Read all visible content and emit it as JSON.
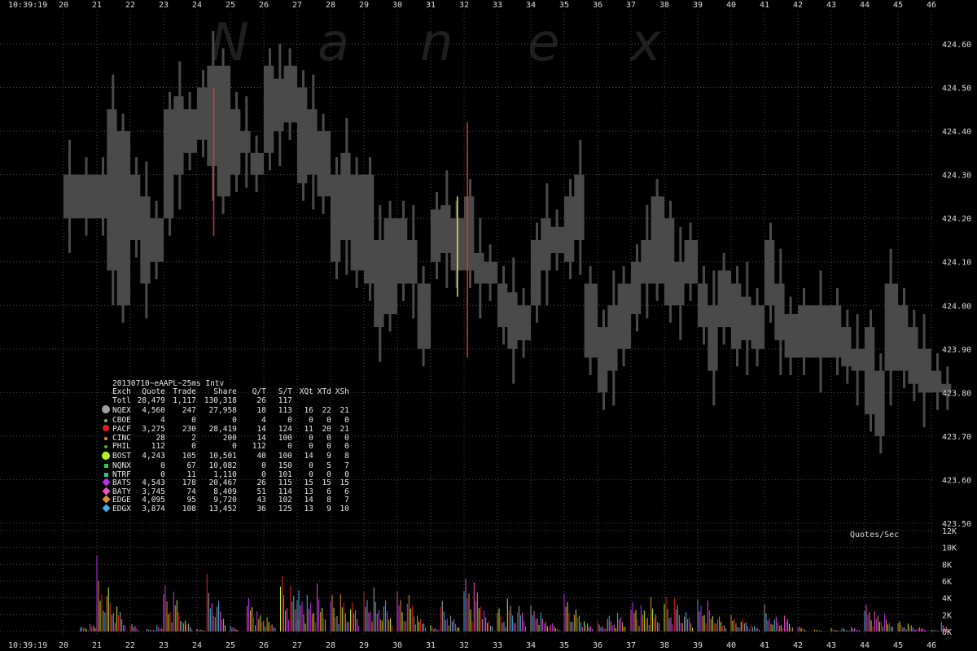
{
  "header_time": "10:39:19",
  "footer_time": "10:39:19",
  "watermark": [
    "N",
    "a",
    "n",
    "e",
    "x"
  ],
  "x_ticks": [
    "20",
    "21",
    "22",
    "23",
    "24",
    "25",
    "26",
    "27",
    "28",
    "29",
    "30",
    "31",
    "32",
    "33",
    "34",
    "35",
    "36",
    "37",
    "38",
    "39",
    "40",
    "41",
    "42",
    "43",
    "44",
    "45",
    "46"
  ],
  "price_ticks": [
    "424.60",
    "424.50",
    "424.40",
    "424.30",
    "424.20",
    "424.10",
    "424.00",
    "423.90",
    "423.80",
    "423.70",
    "423.60",
    "423.50"
  ],
  "volume_ticks": [
    "12K",
    "10K",
    "8K",
    "6K",
    "4K",
    "2K",
    "0K"
  ],
  "volume_label": "Quotes/Sec",
  "stats": {
    "title": "20130710~eAAPL~25ms Intv",
    "headers": [
      "Exch",
      "Quote",
      "Trade",
      "Share",
      "Q/T",
      "S/T",
      "XQt",
      "XTd",
      "XSh"
    ],
    "rows": [
      {
        "exch": "Totl",
        "quote": "28,479",
        "trade": "1,117",
        "share": "130,318",
        "qt": "26",
        "st": "117",
        "xqt": "",
        "xtd": "",
        "xsh": "",
        "color": "",
        "shape": "none"
      },
      {
        "exch": "NQEX",
        "quote": "4,560",
        "trade": "247",
        "share": "27,958",
        "qt": "18",
        "st": "113",
        "xqt": "16",
        "xtd": "22",
        "xsh": "21",
        "color": "#a0a0a0",
        "shape": "big-dot"
      },
      {
        "exch": "CBOE",
        "quote": "4",
        "trade": "0",
        "share": "0",
        "qt": "4",
        "st": "0",
        "xqt": "0",
        "xtd": "0",
        "xsh": "0",
        "color": "#6ac04a",
        "shape": "small-dot"
      },
      {
        "exch": "PACF",
        "quote": "3,275",
        "trade": "230",
        "share": "28,419",
        "qt": "14",
        "st": "124",
        "xqt": "11",
        "xtd": "20",
        "xsh": "21",
        "color": "#e21b1b",
        "shape": "dot"
      },
      {
        "exch": "CINC",
        "quote": "28",
        "trade": "2",
        "share": "200",
        "qt": "14",
        "st": "100",
        "xqt": "0",
        "xtd": "0",
        "xsh": "0",
        "color": "#e0922a",
        "shape": "small-dot"
      },
      {
        "exch": "PHIL",
        "quote": "112",
        "trade": "0",
        "share": "0",
        "qt": "112",
        "st": "0",
        "xqt": "0",
        "xtd": "0",
        "xsh": "0",
        "color": "#44b030",
        "shape": "small-dot"
      },
      {
        "exch": "BOST",
        "quote": "4,243",
        "trade": "105",
        "share": "10,501",
        "qt": "40",
        "st": "100",
        "xqt": "14",
        "xtd": "9",
        "xsh": "8",
        "color": "#b4f028",
        "shape": "big-dot"
      },
      {
        "exch": "NQNX",
        "quote": "0",
        "trade": "67",
        "share": "10,082",
        "qt": "0",
        "st": "150",
        "xqt": "0",
        "xtd": "5",
        "xsh": "7",
        "color": "#2ec84a",
        "shape": "square"
      },
      {
        "exch": "NTRF",
        "quote": "0",
        "trade": "11",
        "share": "1,110",
        "qt": "0",
        "st": "101",
        "xqt": "0",
        "xtd": "0",
        "xsh": "0",
        "color": "#2ec88a",
        "shape": "square"
      },
      {
        "exch": "BATS",
        "quote": "4,543",
        "trade": "178",
        "share": "20,467",
        "qt": "26",
        "st": "115",
        "xqt": "15",
        "xtd": "15",
        "xsh": "15",
        "color": "#c030f0",
        "shape": "diamond"
      },
      {
        "exch": "BATY",
        "quote": "3,745",
        "trade": "74",
        "share": "8,409",
        "qt": "51",
        "st": "114",
        "xqt": "13",
        "xtd": "6",
        "xsh": "6",
        "color": "#f050c8",
        "shape": "diamond"
      },
      {
        "exch": "EDGE",
        "quote": "4,095",
        "trade": "95",
        "share": "9,720",
        "qt": "43",
        "st": "102",
        "xqt": "14",
        "xtd": "8",
        "xsh": "7",
        "color": "#e0902a",
        "shape": "diamond"
      },
      {
        "exch": "EDGX",
        "quote": "3,874",
        "trade": "108",
        "share": "13,452",
        "qt": "36",
        "st": "125",
        "xqt": "13",
        "xtd": "9",
        "xsh": "10",
        "color": "#40b0e8",
        "shape": "diamond"
      }
    ]
  },
  "colors": {
    "band": "#4a4a4a",
    "grid": "#4d4d4d",
    "background": "#000000",
    "trade_red": "#d23a3a",
    "trade_yellow": "#e6e64a"
  },
  "chart_data": {
    "type": "area",
    "title": "",
    "x_unit": "seconds after 10:39",
    "price_axis": {
      "ylim": [
        423.5,
        424.6
      ]
    },
    "volume_axis": {
      "ylim": [
        0,
        12000
      ]
    },
    "nbbo_band": [
      [
        20.0,
        424.3,
        424.2
      ],
      [
        20.5,
        424.3,
        424.2
      ],
      [
        21.0,
        424.3,
        424.2
      ],
      [
        21.3,
        424.45,
        424.08
      ],
      [
        21.6,
        424.4,
        424.0
      ],
      [
        22.0,
        424.3,
        424.15
      ],
      [
        22.3,
        424.25,
        424.05
      ],
      [
        22.6,
        424.2,
        424.1
      ],
      [
        23.0,
        424.45,
        424.2
      ],
      [
        23.3,
        424.48,
        424.3
      ],
      [
        23.6,
        424.45,
        424.35
      ],
      [
        24.0,
        424.5,
        424.38
      ],
      [
        24.3,
        424.55,
        424.32
      ],
      [
        24.6,
        424.55,
        424.25
      ],
      [
        25.0,
        424.45,
        424.3
      ],
      [
        25.3,
        424.4,
        424.35
      ],
      [
        25.6,
        424.35,
        424.3
      ],
      [
        26.0,
        424.55,
        424.35
      ],
      [
        26.3,
        424.52,
        424.4
      ],
      [
        26.6,
        424.55,
        424.42
      ],
      [
        27.0,
        424.5,
        424.28
      ],
      [
        27.3,
        424.45,
        424.3
      ],
      [
        27.6,
        424.4,
        424.25
      ],
      [
        28.0,
        424.3,
        424.1
      ],
      [
        28.3,
        424.35,
        424.15
      ],
      [
        28.6,
        424.3,
        424.08
      ],
      [
        29.0,
        424.3,
        424.05
      ],
      [
        29.3,
        424.15,
        423.95
      ],
      [
        29.6,
        424.2,
        423.98
      ],
      [
        30.0,
        424.2,
        424.05
      ],
      [
        30.3,
        424.15,
        424.05
      ],
      [
        30.6,
        424.05,
        423.9
      ],
      [
        31.0,
        424.22,
        424.1
      ],
      [
        31.3,
        424.23,
        424.12
      ],
      [
        31.6,
        424.2,
        424.08
      ],
      [
        32.0,
        424.25,
        424.08
      ],
      [
        32.3,
        424.12,
        424.05
      ],
      [
        32.6,
        424.1,
        424.05
      ],
      [
        33.0,
        424.05,
        423.95
      ],
      [
        33.3,
        424.03,
        423.9
      ],
      [
        33.6,
        424.0,
        423.92
      ],
      [
        34.0,
        424.15,
        424.0
      ],
      [
        34.3,
        424.2,
        424.08
      ],
      [
        34.6,
        424.18,
        424.12
      ],
      [
        35.0,
        424.25,
        424.1
      ],
      [
        35.3,
        424.3,
        424.15
      ],
      [
        35.6,
        424.05,
        423.88
      ],
      [
        36.0,
        423.95,
        423.8
      ],
      [
        36.3,
        424.0,
        423.85
      ],
      [
        36.6,
        424.05,
        423.9
      ],
      [
        37.0,
        424.1,
        423.98
      ],
      [
        37.3,
        424.15,
        424.05
      ],
      [
        37.6,
        424.25,
        424.05
      ],
      [
        38.0,
        424.2,
        424.0
      ],
      [
        38.3,
        424.1,
        424.0
      ],
      [
        38.6,
        424.15,
        424.05
      ],
      [
        39.0,
        424.05,
        423.95
      ],
      [
        39.3,
        424.0,
        423.85
      ],
      [
        39.6,
        424.08,
        423.95
      ],
      [
        40.0,
        424.05,
        423.9
      ],
      [
        40.3,
        424.02,
        423.92
      ],
      [
        40.6,
        424.0,
        423.9
      ],
      [
        41.0,
        424.15,
        424.0
      ],
      [
        41.3,
        424.05,
        423.92
      ],
      [
        41.6,
        423.98,
        423.88
      ],
      [
        42.0,
        424.0,
        423.88
      ],
      [
        42.5,
        424.0,
        423.88
      ],
      [
        43.0,
        424.0,
        423.88
      ],
      [
        43.3,
        423.95,
        423.86
      ],
      [
        43.6,
        423.9,
        423.85
      ],
      [
        44.0,
        423.95,
        423.75
      ],
      [
        44.3,
        423.85,
        423.7
      ],
      [
        44.6,
        424.05,
        423.85
      ],
      [
        45.0,
        424.0,
        423.85
      ],
      [
        45.3,
        423.95,
        423.82
      ],
      [
        45.6,
        423.9,
        423.8
      ],
      [
        46.0,
        423.85,
        423.8
      ],
      [
        46.3,
        423.82,
        423.8
      ]
    ],
    "volume": {
      "x": [
        20.5,
        20.8,
        21.0,
        21.3,
        21.6,
        22.0,
        22.5,
        22.8,
        23.0,
        23.3,
        23.6,
        24.0,
        24.3,
        24.6,
        25.0,
        25.5,
        25.8,
        26.1,
        26.5,
        26.8,
        27.0,
        27.3,
        27.6,
        28.0,
        28.3,
        28.6,
        29.0,
        29.3,
        29.6,
        30.0,
        30.3,
        30.6,
        31.0,
        31.3,
        31.6,
        32.0,
        32.3,
        32.6,
        33.0,
        33.3,
        33.6,
        34.0,
        34.3,
        34.6,
        35.0,
        35.3,
        35.6,
        36.0,
        36.3,
        36.6,
        37.0,
        37.3,
        37.6,
        38.0,
        38.3,
        38.6,
        39.0,
        39.3,
        39.6,
        40.0,
        40.3,
        40.6,
        41.0,
        41.3,
        41.6,
        42.0,
        42.5,
        43.0,
        43.3,
        43.6,
        44.0,
        44.3,
        44.6,
        45.0,
        45.3,
        45.6,
        46.0,
        46.3
      ],
      "quotes_per_sec": [
        800,
        1200,
        9500,
        6500,
        3500,
        1200,
        400,
        800,
        6800,
        5600,
        1800,
        400,
        7200,
        4500,
        800,
        5500,
        3200,
        1800,
        8200,
        6400,
        6800,
        5800,
        6000,
        5400,
        5200,
        4800,
        6300,
        5500,
        4600,
        5600,
        6000,
        2500,
        800,
        4500,
        2200,
        8700,
        7800,
        2600,
        3400,
        4600,
        4200,
        4100,
        2400,
        1200,
        5300,
        3600,
        1600,
        1300,
        2300,
        2600,
        4800,
        4200,
        4300,
        5100,
        4700,
        3200,
        5100,
        3900,
        2200,
        2300,
        2100,
        1100,
        3400,
        2200,
        2200,
        800,
        300,
        400,
        500,
        600,
        4400,
        3200,
        2200,
        1500,
        1100,
        700,
        300,
        1200
      ]
    },
    "trades": [
      {
        "x": 24.5,
        "low": 424.16,
        "high": 424.5,
        "color": "red"
      },
      {
        "x": 31.8,
        "low": 424.02,
        "high": 424.25,
        "color": "yellow"
      },
      {
        "x": 32.1,
        "low": 423.88,
        "high": 424.42,
        "color": "red"
      }
    ]
  }
}
